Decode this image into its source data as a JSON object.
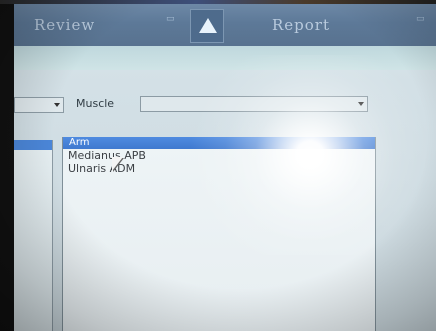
{
  "tabs": {
    "review_label": "Review",
    "report_label": "Report"
  },
  "filters": {
    "muscle_label": "Muscle",
    "muscle_value": ""
  },
  "list": {
    "header": "Arm",
    "items": [
      "Medianus APB",
      "Ulnaris ADM"
    ]
  },
  "icons": {
    "tab_arrow": "up-triangle-icon",
    "pointer": "mouse-pointer-icon"
  }
}
